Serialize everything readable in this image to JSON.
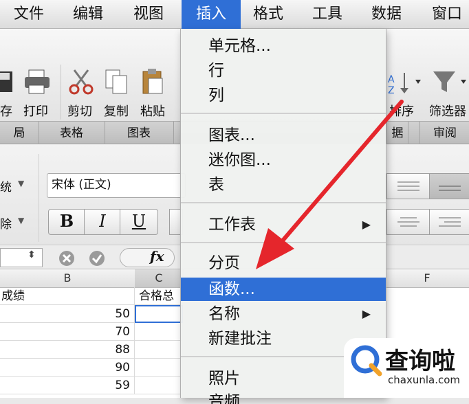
{
  "menubar": {
    "items": [
      "文件",
      "编辑",
      "视图",
      "插入",
      "格式",
      "工具",
      "数据",
      "窗口"
    ],
    "active": "插入"
  },
  "toolbar": {
    "save_label": "存",
    "print_label": "打印",
    "cut_label": "剪切",
    "copy_label": "复制",
    "paste_label": "粘贴",
    "sort_label": "排序",
    "filter_label": "筛选器"
  },
  "tabs": [
    "局",
    "表格",
    "图表",
    "据",
    "审阅"
  ],
  "format": {
    "font_name": "宋体 (正文)",
    "bold": "B",
    "italic": "I",
    "underline": "U",
    "left_partial_1": "统",
    "left_partial_2": "除"
  },
  "formulabar": {
    "fx": "fx"
  },
  "sheet": {
    "columns": [
      "B",
      "C",
      "F"
    ],
    "col_b_header": "成绩",
    "col_c_header": "合格总",
    "scores": [
      "50",
      "70",
      "88",
      "90",
      "59"
    ]
  },
  "dropdown": {
    "items": [
      "单元格...",
      "行",
      "列",
      "图表...",
      "迷你图...",
      "表",
      "工作表",
      "分页",
      "函数...",
      "名称",
      "新建批注",
      "照片",
      "音频"
    ],
    "highlighted": "函数...",
    "submenu_marker": "▶"
  },
  "annotation": {
    "arrow_color": "#e5262c"
  },
  "logo": {
    "brand": "查询啦",
    "url_text": "chaxunla.com",
    "accent": "#2f6fd6"
  }
}
